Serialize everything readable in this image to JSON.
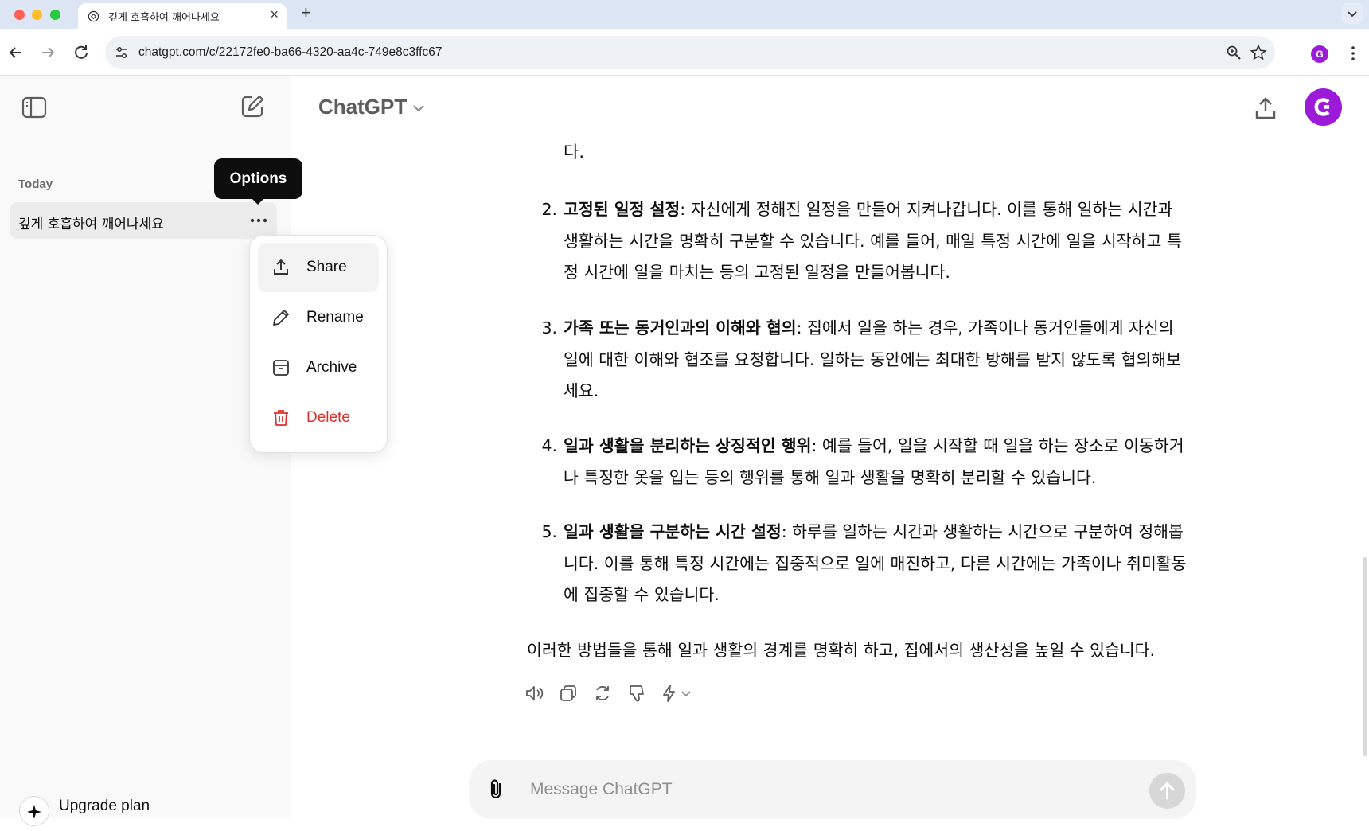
{
  "browser": {
    "tab_title": "깊게 호흡하여 깨어나세요",
    "tab_close": "×",
    "new_tab": "+",
    "url": "chatgpt.com/c/22172fe0-ba66-4320-aa4c-749e8c3ffc67",
    "profile_initial": "G",
    "profile_color": "#9b1bd8"
  },
  "sidebar": {
    "section_label": "Today",
    "conversation_title": "깊게 호흡하여 깨어나세요",
    "upgrade_label": "Upgrade plan"
  },
  "tooltip": {
    "text": "Options"
  },
  "menu": {
    "items": [
      {
        "label": "Share",
        "icon": "share-icon"
      },
      {
        "label": "Rename",
        "icon": "pencil-icon"
      },
      {
        "label": "Archive",
        "icon": "archive-icon"
      },
      {
        "label": "Delete",
        "icon": "trash-icon",
        "color": "#e02e2a"
      }
    ]
  },
  "header": {
    "model_name": "ChatGPT"
  },
  "conversation": {
    "partial_line": "다.",
    "list": [
      {
        "num": "2.",
        "title": "고정된 일정 설정",
        "text": ": 자신에게 정해진 일정을 만들어 지켜나갑니다. 이를 통해 일하는 시간과 생활하는 시간을 명확히 구분할 수 있습니다. 예를 들어, 매일 특정 시간에 일을 시작하고 특정 시간에 일을 마치는 등의 고정된 일정을 만들어봅니다."
      },
      {
        "num": "3.",
        "title": "가족 또는 동거인과의 이해와 협의",
        "text": ": 집에서 일을 하는 경우, 가족이나 동거인들에게 자신의 일에 대한 이해와 협조를 요청합니다. 일하는 동안에는 최대한 방해를 받지 않도록 협의해보세요."
      },
      {
        "num": "4.",
        "title": "일과 생활을 분리하는 상징적인 행위",
        "text": ": 예를 들어, 일을 시작할 때 일을 하는 장소로 이동하거나 특정한 옷을 입는 등의 행위를 통해 일과 생활을 명확히 분리할 수 있습니다."
      },
      {
        "num": "5.",
        "title": "일과 생활을 구분하는 시간 설정",
        "text": ": 하루를 일하는 시간과 생활하는 시간으로 구분하여 정해봅니다. 이를 통해 특정 시간에는 집중적으로 일에 매진하고, 다른 시간에는 가족이나 취미활동에 집중할 수 있습니다."
      }
    ],
    "summary": "이러한 방법들을 통해 일과 생활의 경계를 명확히 하고, 집에서의 생산성을 높일 수 있습니다."
  },
  "composer": {
    "placeholder": "Message ChatGPT"
  }
}
